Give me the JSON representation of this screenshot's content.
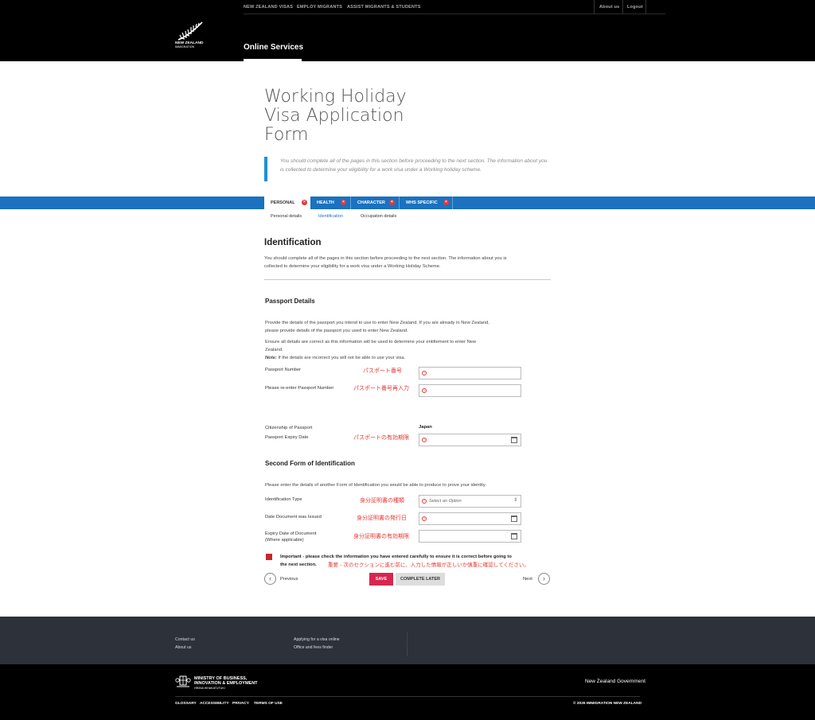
{
  "header": {
    "nav": [
      "NEW ZEALAND VISAS",
      "EMPLOY MIGRANTS",
      "ASSIST MIGRANTS & STUDENTS"
    ],
    "about": "About us",
    "logout": "Logout",
    "logo_line1": "NEW ZEALAND",
    "logo_line2": "IMMIGRATION",
    "section": "Online Services"
  },
  "title_lines": [
    "Working Holiday",
    "Visa Application",
    "Form"
  ],
  "lead": "You should complete all of the pages in this section before proceeding to the next section. The information about you is collected to determine your eligibility for a work visa under a Working holiday scheme.",
  "tabs": [
    {
      "label": "PERSONAL"
    },
    {
      "label": "HEALTH"
    },
    {
      "label": "CHARACTER"
    },
    {
      "label": "WHS SPECIFIC"
    }
  ],
  "tab_close": "×",
  "subnav": [
    "Personal details",
    "Identification",
    "Occupation details"
  ],
  "ident": {
    "heading": "Identification",
    "intro_1": "You should complete all of the pages in this section before proceeding to the next section. The information about you is",
    "intro_2": "collected to determine your eligibility for a work visa under a Working Holiday Scheme."
  },
  "passport": {
    "heading": "Passport Details",
    "p1_1": "Provide the details of the passport you intend to use to enter New Zealand. If you are already in New Zealand,",
    "p1_2": "please provide details of the passport you used to enter New Zealand.",
    "p2_1": "Ensure all details are correct as this information will be used to determine your entitlement to enter New",
    "p2_2": "Zealand.",
    "note_label": "Note:",
    "note_text": " If the details are incorrect you will not be able to use your visa.",
    "number_label": "Passport Number",
    "number_jp": "パスポート番号",
    "reenter_label": "Please re-enter Passport Number",
    "reenter_jp": "パスポート番号再入力",
    "citizenship_label": "Citizenship of Passport",
    "citizenship_value": "Japan",
    "expiry_label": "Passport Expiry Date",
    "expiry_jp": "パスポートの有効期限"
  },
  "second": {
    "heading": "Second Form of Identification",
    "intro": "Please enter the details of another Form of Identification you would be able to produce to prove your identity.",
    "type_label": "Identification Type",
    "type_jp": "身分証明書の種類",
    "type_placeholder": "Select an Option",
    "issued_label": "Date Document was Issued",
    "issued_jp": "身分証明書の発行日",
    "expiry_label_1": "Expiry Date of Document",
    "expiry_label_2": "(Where applicable)",
    "expiry_jp": "身分証明書の有効期限"
  },
  "important": {
    "text_1": "Important - please check the information you have entered carefully to ensure it is correct before going to",
    "text_2": "the next section.",
    "jp": "重要 - 次のセクションに進む前に、入力した情報が正しいか慎重に確認してください。"
  },
  "actions": {
    "previous": "Previous",
    "next": "Next",
    "save": "SAVE",
    "later": "COMPLETE LATER",
    "prev_glyph": "‹",
    "next_glyph": "›"
  },
  "footer": {
    "contact": "Contact us",
    "about": "About us",
    "applying": "Applying for a visa online",
    "office": "Office and fees finder",
    "mbie_1": "MINISTRY OF BUSINESS,",
    "mbie_2": "INNOVATION & EMPLOYMENT",
    "mbie_3": "HĪKINA WHAKATUTUKI",
    "nzgov": "New Zealand Government",
    "legal": [
      "GLOSSARY",
      "ACCESSIBILITY",
      "PRIVACY",
      "TERMS OF USE"
    ],
    "copyright": "© 2026 IMMIGRATION NEW ZEALAND"
  },
  "colors": {
    "tab_blue": "#1a72c0",
    "accent_blue": "#1f8fd6",
    "save_red": "#d8254f",
    "error_red": "#e0393e",
    "jp_annotation": "#e8362f"
  },
  "icons": [
    "fern-logo-icon",
    "error-icon",
    "calendar-icon",
    "chevron-left-icon",
    "chevron-right-icon",
    "flag-icon",
    "crest-icon",
    "close-icon"
  ]
}
